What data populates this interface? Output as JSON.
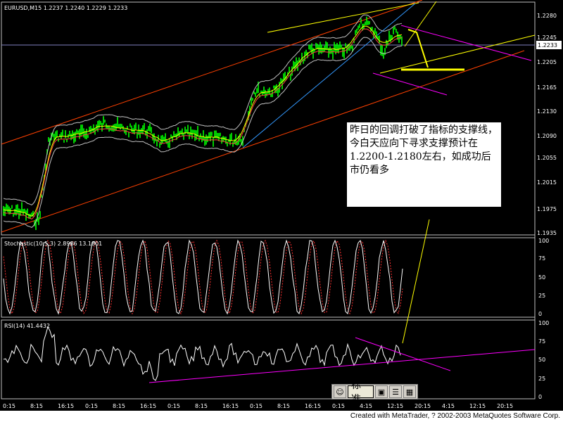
{
  "main_chart": {
    "symbol_label": "EURUSD,M15  1.2237 1.2240 1.2229 1.2233",
    "price_labels": [
      "1.2280",
      "1.2245",
      "1.2205",
      "1.2165",
      "1.2130",
      "1.2090",
      "1.2055",
      "1.2015",
      "1.1975",
      "1.1935"
    ],
    "current_price": "1.2233"
  },
  "annotation": {
    "text": "昨日的回调打破了指标的支撑线，今白天应向下寻求支撑预计在1.2200-1.2180左右，如成功后市仍看多"
  },
  "stochastic": {
    "label": "Stochastic(10,5,3)  2.8986  13.1801",
    "scale": [
      "100",
      "75",
      "50",
      "25",
      "0"
    ]
  },
  "rsi": {
    "label": "RSI(14)  41.4432",
    "scale": [
      "100",
      "75",
      "50",
      "25",
      "0"
    ]
  },
  "time_axis": [
    "0:15",
    "8:15",
    "16:15",
    "0:15",
    "8:15",
    "16:15",
    "0:15",
    "8:15",
    "16:15",
    "0:15",
    "8:15",
    "16:15",
    "0:15",
    "4:15",
    "12:15",
    "20:15",
    "4:15",
    "12:15",
    "20:15"
  ],
  "toolbar": {
    "main_label": "标准",
    "buttons": [
      "▣",
      "☰",
      "▫",
      "▦"
    ]
  },
  "footer": {
    "credit": "Created with MetaTrader, ? 2002-2003 MetaQuotes Software Corp."
  },
  "colors": {
    "candles": "#00ff00",
    "channel": "#ff4000",
    "trend_yellow": "#ffff00",
    "trend_magenta": "#ff00ff",
    "blue_line": "#3399ff"
  }
}
